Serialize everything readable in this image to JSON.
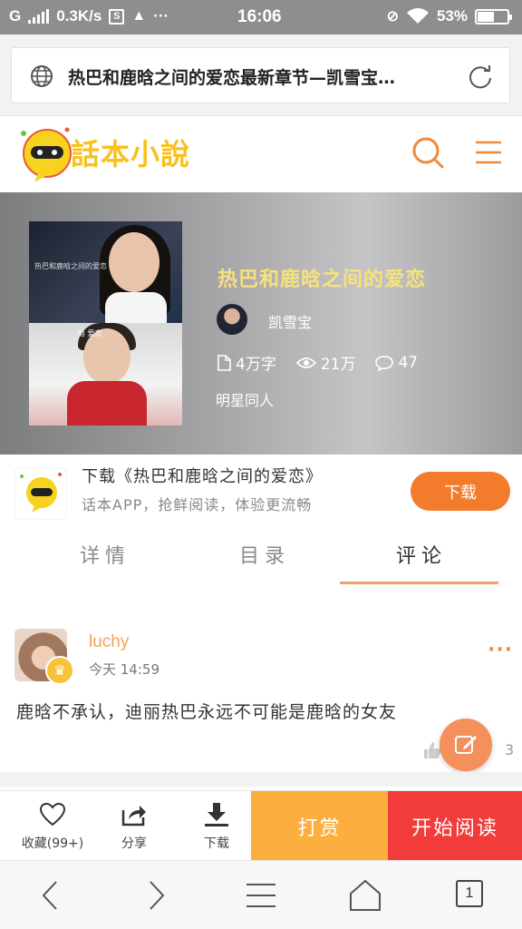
{
  "status": {
    "carrier": "G",
    "speed": "0.3K/s",
    "time": "16:06",
    "battery": "53%",
    "battery_level": 0.53
  },
  "browser": {
    "page_title": "热巴和鹿晗之间的爱恋最新章节—凯雪宝…"
  },
  "site": {
    "logo_text": "話本小說"
  },
  "book": {
    "title": "热巴和鹿晗之间的爱恋",
    "author": "凯雪宝",
    "words": "4万字",
    "views": "21万",
    "comments": "47",
    "genre": "明星同人",
    "cover_caption_1": "热巴和鹿晗之间的爱恋",
    "cover_caption_2": "晗 爱恋"
  },
  "download_banner": {
    "title": "下载《热巴和鹿晗之间的爱恋》",
    "subtitle": "话本APP，抢鲜阅读，体验更流畅",
    "button": "下载"
  },
  "tabs": [
    {
      "label": "详情"
    },
    {
      "label": "目录"
    },
    {
      "label": "评论"
    }
  ],
  "comment": {
    "user": "luchy",
    "time": "今天 14:59",
    "text": "鹿晗不承认，迪丽热巴永远不可能是鹿晗的女友",
    "reply_count": "3"
  },
  "actions": {
    "favorite": "收藏(99+)",
    "share": "分享",
    "download": "下载",
    "reward": "打赏",
    "read": "开始阅读"
  },
  "sysnav": {
    "tab_count": "1"
  },
  "colors": {
    "accent_orange": "#f27b2c",
    "reward_yellow": "#fcae3f",
    "read_red": "#f23b3b",
    "title_yellow": "#f6e27a"
  }
}
